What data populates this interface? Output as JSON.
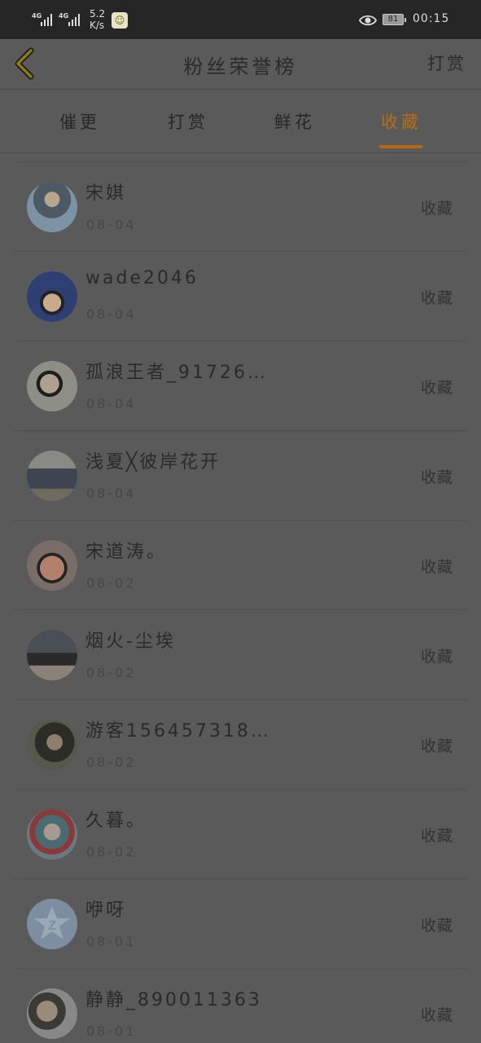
{
  "status_bar": {
    "net1": "4G",
    "net2": "4G",
    "speed_value": "5.2",
    "speed_unit": "K/s",
    "battery": "81",
    "time": "00:15"
  },
  "header": {
    "title": "粉丝荣誉榜",
    "right_action": "打赏"
  },
  "tabs": [
    {
      "label": "催更"
    },
    {
      "label": "打赏"
    },
    {
      "label": "鲜花"
    },
    {
      "label": "收藏"
    }
  ],
  "active_tab": "收藏",
  "colors": {
    "accent": "#b36f14",
    "background": "#5a5a5a",
    "status_bar": "#262626"
  },
  "fans": [
    {
      "name": "宋娸",
      "date": "08-04",
      "action": "收藏"
    },
    {
      "name": "wade2046",
      "date": "08-04",
      "action": "收藏"
    },
    {
      "name": "孤浪王者_91726…",
      "date": "08-04",
      "action": "收藏"
    },
    {
      "name": "浅夏╳彼岸花开",
      "date": "08-04",
      "action": "收藏"
    },
    {
      "name": "宋道涛。",
      "date": "08-02",
      "action": "收藏"
    },
    {
      "name": "烟火-尘埃",
      "date": "08-02",
      "action": "收藏"
    },
    {
      "name": "游客156457318…",
      "date": "08-02",
      "action": "收藏"
    },
    {
      "name": "久暮。",
      "date": "08-02",
      "action": "收藏"
    },
    {
      "name": "咿呀",
      "date": "08-01",
      "action": "收藏"
    },
    {
      "name": "静静_890011363",
      "date": "08-01",
      "action": "收藏"
    }
  ]
}
